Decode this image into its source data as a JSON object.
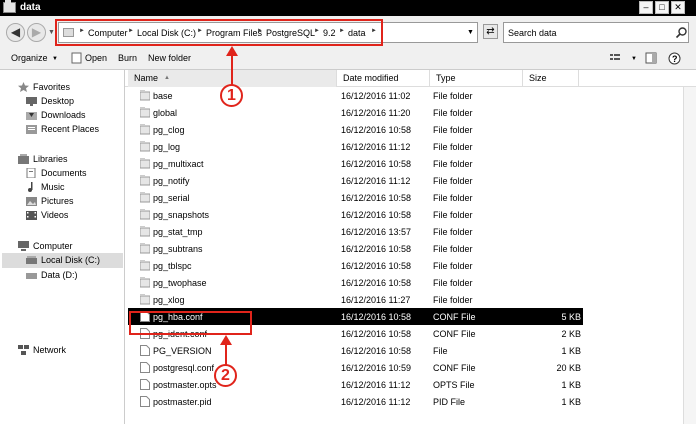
{
  "window": {
    "title": "data",
    "controls": {
      "minimize": "–",
      "maximize": "□",
      "close": "✕"
    }
  },
  "address_bar": {
    "breadcrumbs": [
      "Computer",
      "Local Disk (C:)",
      "Program Files",
      "PostgreSQL",
      "9.2",
      "data"
    ],
    "search_placeholder": "Search data"
  },
  "toolbar": {
    "organize": "Organize",
    "open": "Open",
    "burn": "Burn",
    "new_folder": "New folder"
  },
  "nav_pane": {
    "favorites": {
      "label": "Favorites",
      "items": [
        "Desktop",
        "Downloads",
        "Recent Places"
      ]
    },
    "libraries": {
      "label": "Libraries",
      "items": [
        "Documents",
        "Music",
        "Pictures",
        "Videos"
      ]
    },
    "computer": {
      "label": "Computer",
      "items": [
        "Local Disk (C:)",
        "Data (D:)"
      ],
      "selected": "Local Disk (C:)"
    },
    "network": {
      "label": "Network"
    }
  },
  "columns": {
    "name": "Name",
    "date": "Date modified",
    "type": "Type",
    "size": "Size"
  },
  "files": [
    {
      "name": "base",
      "date": "16/12/2016 11:02",
      "type": "File folder",
      "size": "",
      "kind": "folder"
    },
    {
      "name": "global",
      "date": "16/12/2016 11:20",
      "type": "File folder",
      "size": "",
      "kind": "folder"
    },
    {
      "name": "pg_clog",
      "date": "16/12/2016 10:58",
      "type": "File folder",
      "size": "",
      "kind": "folder"
    },
    {
      "name": "pg_log",
      "date": "16/12/2016 11:12",
      "type": "File folder",
      "size": "",
      "kind": "folder"
    },
    {
      "name": "pg_multixact",
      "date": "16/12/2016 10:58",
      "type": "File folder",
      "size": "",
      "kind": "folder"
    },
    {
      "name": "pg_notify",
      "date": "16/12/2016 11:12",
      "type": "File folder",
      "size": "",
      "kind": "folder"
    },
    {
      "name": "pg_serial",
      "date": "16/12/2016 10:58",
      "type": "File folder",
      "size": "",
      "kind": "folder"
    },
    {
      "name": "pg_snapshots",
      "date": "16/12/2016 10:58",
      "type": "File folder",
      "size": "",
      "kind": "folder"
    },
    {
      "name": "pg_stat_tmp",
      "date": "16/12/2016 13:57",
      "type": "File folder",
      "size": "",
      "kind": "folder"
    },
    {
      "name": "pg_subtrans",
      "date": "16/12/2016 10:58",
      "type": "File folder",
      "size": "",
      "kind": "folder"
    },
    {
      "name": "pg_tblspc",
      "date": "16/12/2016 10:58",
      "type": "File folder",
      "size": "",
      "kind": "folder"
    },
    {
      "name": "pg_twophase",
      "date": "16/12/2016 10:58",
      "type": "File folder",
      "size": "",
      "kind": "folder"
    },
    {
      "name": "pg_xlog",
      "date": "16/12/2016 11:27",
      "type": "File folder",
      "size": "",
      "kind": "folder"
    },
    {
      "name": "pg_hba.conf",
      "date": "16/12/2016 10:58",
      "type": "CONF File",
      "size": "5 KB",
      "kind": "file",
      "selected": true
    },
    {
      "name": "pg_ident.conf",
      "date": "16/12/2016 10:58",
      "type": "CONF File",
      "size": "2 KB",
      "kind": "file"
    },
    {
      "name": "PG_VERSION",
      "date": "16/12/2016 10:58",
      "type": "File",
      "size": "1 KB",
      "kind": "file"
    },
    {
      "name": "postgresql.conf",
      "date": "16/12/2016 10:59",
      "type": "CONF File",
      "size": "20 KB",
      "kind": "file"
    },
    {
      "name": "postmaster.opts",
      "date": "16/12/2016 11:12",
      "type": "OPTS File",
      "size": "1 KB",
      "kind": "file"
    },
    {
      "name": "postmaster.pid",
      "date": "16/12/2016 11:12",
      "type": "PID File",
      "size": "1 KB",
      "kind": "file"
    }
  ],
  "annotations": {
    "callout_1": "1",
    "callout_2": "2",
    "color": "#e0241b"
  }
}
